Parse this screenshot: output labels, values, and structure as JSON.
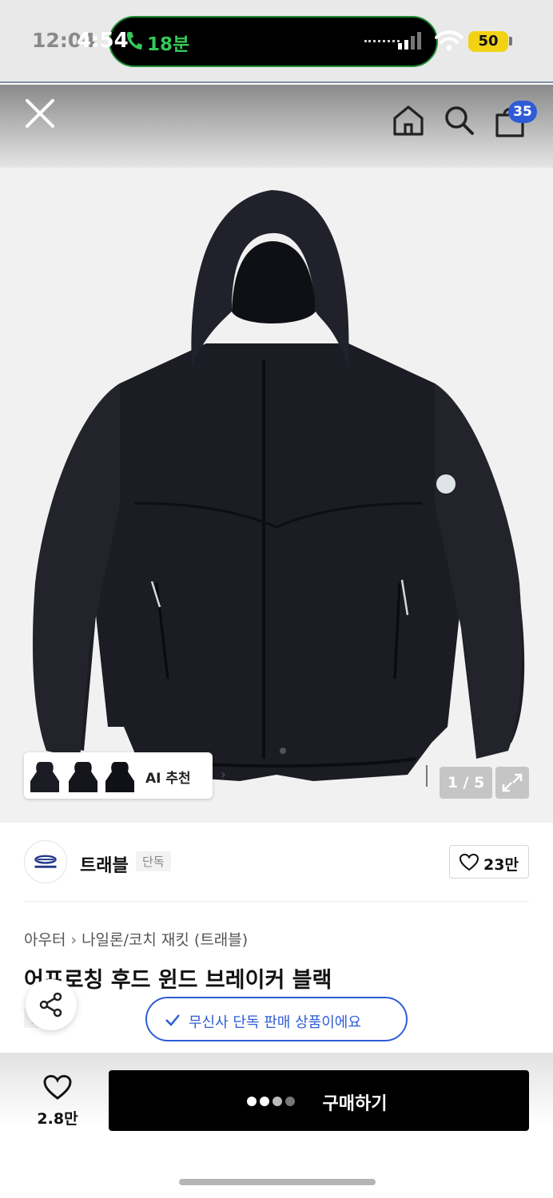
{
  "status_bar": {
    "time_background": "12:04",
    "time": "4:54",
    "call_duration": "18분",
    "battery": "50"
  },
  "header": {
    "cart_count": "35",
    "accent_color": "#2f5cd6"
  },
  "gallery": {
    "ai_recommend_label": "AI 추천",
    "page_counter": "1 / 5"
  },
  "brand": {
    "name": "트래블",
    "exclusive_tag": "단독",
    "like_count": "23만"
  },
  "product": {
    "breadcrumb": [
      "아우터",
      "나일론/코치 재킷 (트래블)"
    ],
    "title": "어프로칭 후드 윈드 브레이커 블랙",
    "exclusive_tag": "단독",
    "exclusive_notice": "무신사 단독 판매 상품이에요"
  },
  "bottom_bar": {
    "wish_count": "2.8만",
    "buy_label": "구매하기"
  }
}
